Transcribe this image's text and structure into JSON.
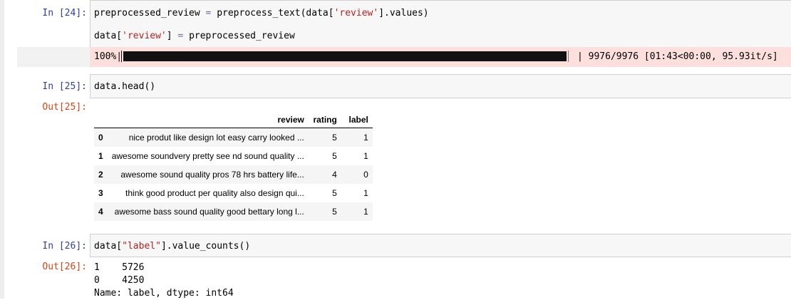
{
  "cells": {
    "c24": {
      "prompt": "In [24]:",
      "line1": {
        "a": "preprocessed_review ",
        "op": "=",
        "b": " preprocess_text(data[",
        "str": "'review'",
        "c": "].values)"
      },
      "line2": {
        "a": "data[",
        "str": "'review'",
        "b": "] ",
        "op": "=",
        "c": " preprocessed_review"
      },
      "stderr": {
        "percent_label": "100%|",
        "progress_fraction": 1.0,
        "stats": "| 9976/9976 [01:43<00:00, 95.93it/s]"
      }
    },
    "c25": {
      "prompt_in": "In [25]:",
      "code": "data.head()",
      "prompt_out": "Out[25]:",
      "table": {
        "columns": [
          "review",
          "rating",
          "label"
        ],
        "rows": [
          {
            "index": "0",
            "review": "nice produt like design lot easy carry looked ...",
            "rating": "5",
            "label": "1"
          },
          {
            "index": "1",
            "review": "awesome soundvery pretty see nd sound quality ...",
            "rating": "5",
            "label": "1"
          },
          {
            "index": "2",
            "review": "awesome sound quality pros 78 hrs battery life...",
            "rating": "4",
            "label": "0"
          },
          {
            "index": "3",
            "review": "think good product per quality also design qui...",
            "rating": "5",
            "label": "1"
          },
          {
            "index": "4",
            "review": "awesome bass sound quality good bettary long l...",
            "rating": "5",
            "label": "1"
          }
        ]
      }
    },
    "c26": {
      "prompt_in": "In [26]:",
      "code": {
        "a": "data[",
        "str": "\"label\"",
        "b": "].value_counts()"
      },
      "prompt_out": "Out[26]:",
      "output_lines": [
        "1    5726",
        "0    4250",
        "Name: label, dtype: int64"
      ]
    }
  }
}
